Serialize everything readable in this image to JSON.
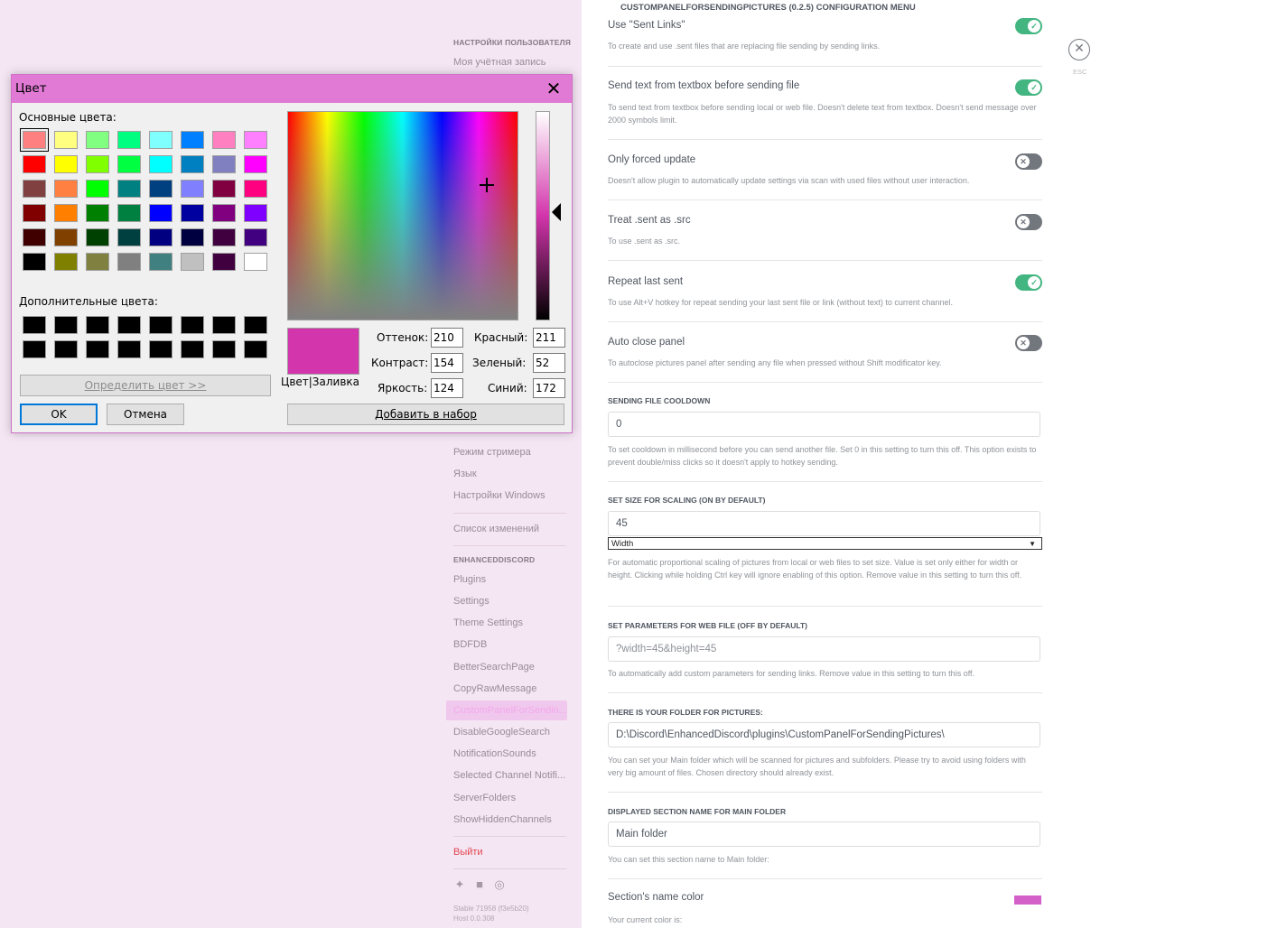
{
  "sidebar": {
    "user_settings_header": "НАСТРОЙКИ ПОЛЬЗОВАТЕЛЯ",
    "my_account": "Моя учётная запись",
    "streamer_mode": "Режим стримера",
    "language": "Язык",
    "windows_settings": "Настройки Windows",
    "changelog": "Список изменений",
    "ed_header": "ENHANCEDDISCORD",
    "ed_items": [
      "Plugins",
      "Settings",
      "Theme Settings",
      "BDFDB",
      "BetterSearchPage",
      "CopyRawMessage",
      "CustomPanelForSendin...",
      "DisableGoogleSearch",
      "NotificationSounds",
      "Selected Channel Notifi...",
      "ServerFolders",
      "ShowHiddenChannels"
    ],
    "logout": "Выйти",
    "version_lines": [
      "Stable 71958 (f3e5b20)",
      "Host 0.0.308"
    ]
  },
  "config": {
    "title": "CUSTOMPANELFORSENDINGPICTURES (0.2.5) CONFIGURATION MENU",
    "toggles": [
      {
        "title": "Use \"Sent Links\"",
        "note": "To create and use .sent files that are replacing file sending by sending links.",
        "on": true
      },
      {
        "title": "Send text from textbox before sending file",
        "note": "To send text from textbox before sending local or web file. Doesn't delete text from textbox. Doesn't send message over 2000 symbols limit.",
        "on": true
      },
      {
        "title": "Only forced update",
        "note": "Doesn't allow plugin to automatically update settings via scan with used files without user interaction.",
        "on": false
      },
      {
        "title": "Treat .sent as .src",
        "note": "To use .sent as .src.",
        "on": false
      },
      {
        "title": "Repeat last sent",
        "note": "To use Alt+V hotkey for repeat sending your last sent file or link (without text) to current channel.",
        "on": true
      },
      {
        "title": "Auto close panel",
        "note": "To autoclose pictures panel after sending any file when pressed without Shift modificator key.",
        "on": false
      }
    ],
    "cooldown": {
      "label": "SENDING FILE COOLDOWN",
      "value": "0",
      "note": "To set cooldown in millisecond before you can send another file. Set 0 in this setting to turn this off. This option exists to prevent double/miss clicks so it doesn't apply to hotkey sending."
    },
    "scaling": {
      "label": "SET SIZE FOR SCALING (ON BY DEFAULT)",
      "value": "45",
      "select": "Width",
      "note": "For automatic proportional scaling of pictures from local or web files to set size. Value is set only either for width or height. Clicking while holding Ctrl key will ignore enabling of this option. Remove value in this setting to turn this off."
    },
    "web_params": {
      "label": "SET PARAMETERS FOR WEB FILE (OFF BY DEFAULT)",
      "placeholder": "?width=45&height=45",
      "note": "To automatically add custom parameters for sending links. Remove value in this setting to turn this off."
    },
    "folder": {
      "label": "THERE IS YOUR FOLDER FOR PICTURES:",
      "value": "D:\\Discord\\EnhancedDiscord\\plugins\\CustomPanelForSendingPictures\\",
      "note": "You can set your Main folder which will be scanned for pictures and subfolders. Please try to avoid using folders with very big amount of files. Chosen directory should already exist."
    },
    "section_name": {
      "label": "DISPLAYED SECTION NAME FOR MAIN FOLDER",
      "value": "Main folder",
      "note": "You can set this section name to Main folder:"
    },
    "section_color": {
      "title": "Section's name color",
      "note": "Your current color is:",
      "color": "#d35fc9"
    },
    "esc_label": "ESC"
  },
  "dialog": {
    "title": "Цвет",
    "basic_colors_label": "Основные цвета:",
    "custom_colors_label": "Дополнительные цвета:",
    "define_button": "Определить цвет >>",
    "ok_button": "OK",
    "cancel_button": "Отмена",
    "add_button": "Добавить в набор",
    "preview_label": "Цвет|Заливка",
    "hue_label": "Оттенок:",
    "sat_label": "Контраст:",
    "lum_label": "Яркость:",
    "red_label": "Красный:",
    "green_label": "Зеленый:",
    "blue_label": "Синий:",
    "hue": "210",
    "sat": "154",
    "lum": "124",
    "red": "211",
    "green": "52",
    "blue": "172",
    "current_color": "#d335ac",
    "basic_colors": [
      "#ff8080",
      "#ffff80",
      "#80ff80",
      "#00ff80",
      "#80ffff",
      "#0080ff",
      "#ff80c0",
      "#ff80ff",
      "#ff0000",
      "#ffff00",
      "#80ff00",
      "#00ff40",
      "#00ffff",
      "#0080c0",
      "#8080c0",
      "#ff00ff",
      "#804040",
      "#ff8040",
      "#00ff00",
      "#008080",
      "#004080",
      "#8080ff",
      "#800040",
      "#ff0080",
      "#800000",
      "#ff8000",
      "#008000",
      "#008040",
      "#0000ff",
      "#0000a0",
      "#800080",
      "#8000ff",
      "#400000",
      "#804000",
      "#004000",
      "#004040",
      "#000080",
      "#000040",
      "#400040",
      "#400080",
      "#000000",
      "#808000",
      "#808040",
      "#808080",
      "#408080",
      "#c0c0c0",
      "#400040",
      "#ffffff"
    ],
    "custom_colors": [
      "#000000",
      "#000000",
      "#000000",
      "#000000",
      "#000000",
      "#000000",
      "#000000",
      "#000000",
      "#000000",
      "#000000",
      "#000000",
      "#000000",
      "#000000",
      "#000000",
      "#000000",
      "#000000"
    ]
  }
}
